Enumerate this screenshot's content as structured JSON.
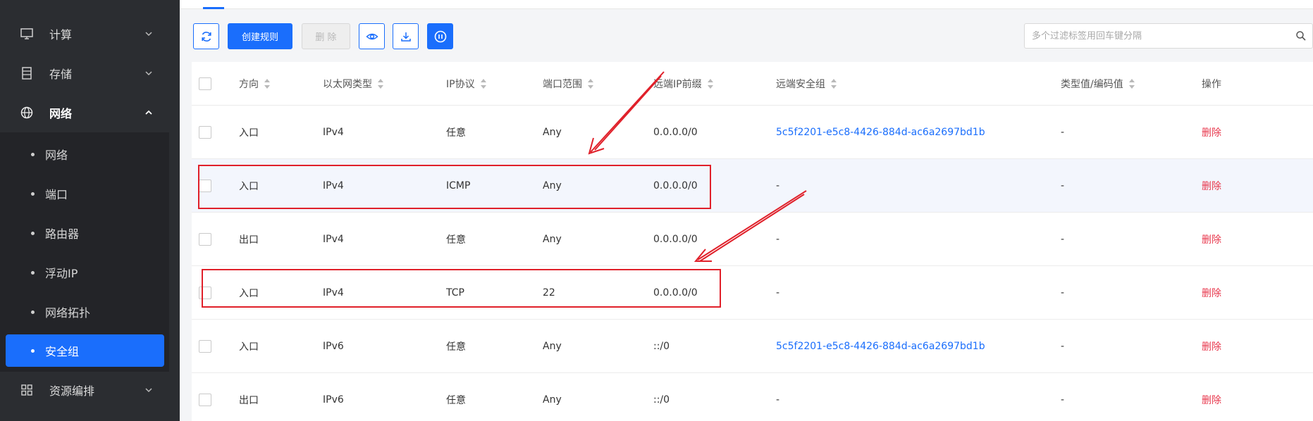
{
  "sidebar": {
    "groups": [
      {
        "label": "计算",
        "icon": "monitor-icon"
      },
      {
        "label": "存储",
        "icon": "storage-icon"
      },
      {
        "label": "网络",
        "icon": "globe-icon"
      },
      {
        "label": "资源编排",
        "icon": "grid-icon"
      }
    ],
    "network_items": [
      {
        "label": "网络"
      },
      {
        "label": "端口"
      },
      {
        "label": "路由器"
      },
      {
        "label": "浮动IP"
      },
      {
        "label": "网络拓扑"
      },
      {
        "label": "安全组",
        "active": true
      }
    ]
  },
  "toolbar": {
    "create_label": "创建规则",
    "delete_label": "删 除",
    "search_placeholder": "多个过滤标签用回车键分隔"
  },
  "table": {
    "headers": [
      "方向",
      "以太网类型",
      "IP协议",
      "端口范围",
      "远端IP前缀",
      "远端安全组",
      "类型值/编码值",
      "操作"
    ],
    "rows": [
      {
        "direction": "入口",
        "ether": "IPv4",
        "protocol": "任意",
        "port": "Any",
        "prefix": "0.0.0.0/0",
        "group": "5c5f2201-e5c8-4426-884d-ac6a2697bd1b",
        "type": "-",
        "action": "删除"
      },
      {
        "direction": "入口",
        "ether": "IPv4",
        "protocol": "ICMP",
        "port": "Any",
        "prefix": "0.0.0.0/0",
        "group": "-",
        "type": "-",
        "action": "删除"
      },
      {
        "direction": "出口",
        "ether": "IPv4",
        "protocol": "任意",
        "port": "Any",
        "prefix": "0.0.0.0/0",
        "group": "-",
        "type": "-",
        "action": "删除"
      },
      {
        "direction": "入口",
        "ether": "IPv4",
        "protocol": "TCP",
        "port": "22",
        "prefix": "0.0.0.0/0",
        "group": "-",
        "type": "-",
        "action": "删除"
      },
      {
        "direction": "入口",
        "ether": "IPv6",
        "protocol": "任意",
        "port": "Any",
        "prefix": "::/0",
        "group": "5c5f2201-e5c8-4426-884d-ac6a2697bd1b",
        "type": "-",
        "action": "删除"
      },
      {
        "direction": "出口",
        "ether": "IPv6",
        "protocol": "任意",
        "port": "Any",
        "prefix": "::/0",
        "group": "-",
        "type": "-",
        "action": "删除"
      }
    ]
  },
  "colors": {
    "accent": "#1a6efc",
    "danger": "#e8384d",
    "annotation": "#e0202a",
    "sidebar_bg": "#2b2d31"
  }
}
